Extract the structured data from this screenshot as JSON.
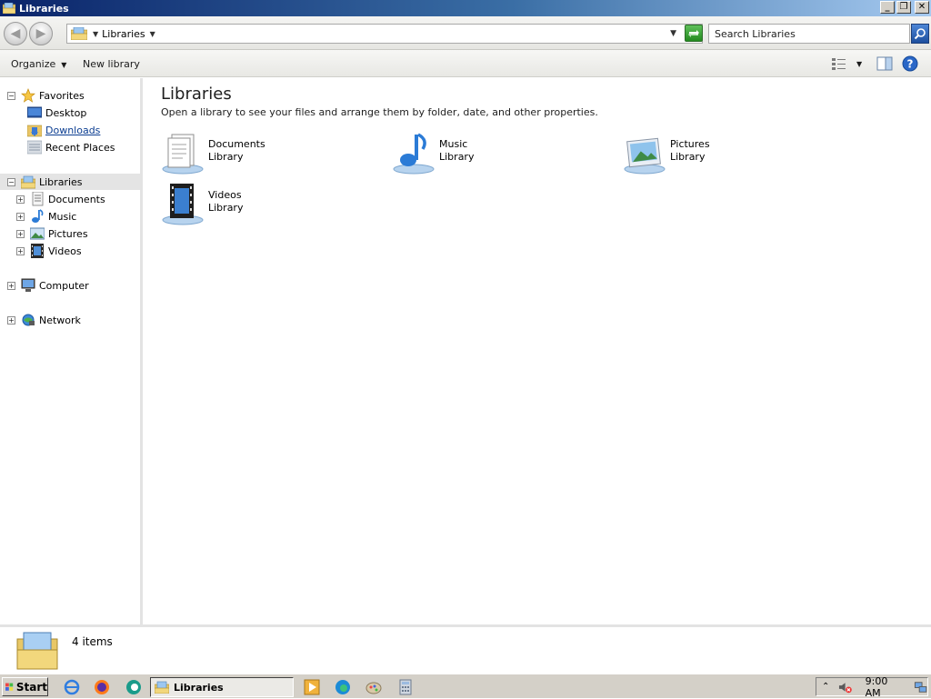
{
  "window": {
    "title": "Libraries",
    "buttons": {
      "minimize": "_",
      "maximize": "❐",
      "close": "✕"
    }
  },
  "address": {
    "crumb": "Libraries",
    "search_placeholder": "Search Libraries"
  },
  "toolbar": {
    "organize_label": "Organize",
    "new_library_label": "New library"
  },
  "nav": {
    "favorites": {
      "label": "Favorites",
      "items": [
        "Desktop",
        "Downloads",
        "Recent Places"
      ]
    },
    "libraries": {
      "label": "Libraries",
      "items": [
        "Documents",
        "Music",
        "Pictures",
        "Videos"
      ]
    },
    "computer": "Computer",
    "network": "Network"
  },
  "content": {
    "heading": "Libraries",
    "subtext": "Open a library to see your files and arrange them by folder, date, and other properties.",
    "libraries": [
      {
        "name": "Documents",
        "type": "Library",
        "icon": "documents-library-icon"
      },
      {
        "name": "Music",
        "type": "Library",
        "icon": "music-library-icon"
      },
      {
        "name": "Pictures",
        "type": "Library",
        "icon": "pictures-library-icon"
      },
      {
        "name": "Videos",
        "type": "Library",
        "icon": "videos-library-icon"
      }
    ]
  },
  "details": {
    "count": "4 items"
  },
  "taskbar": {
    "start_label": "Start",
    "active_window": "Libraries",
    "clock": "9:00 AM"
  },
  "colors": {
    "titlebar_start": "#0a246a",
    "titlebar_end": "#a6caf0",
    "selection_gray": "#e4e4e4",
    "link_blue": "#0b3d91"
  }
}
